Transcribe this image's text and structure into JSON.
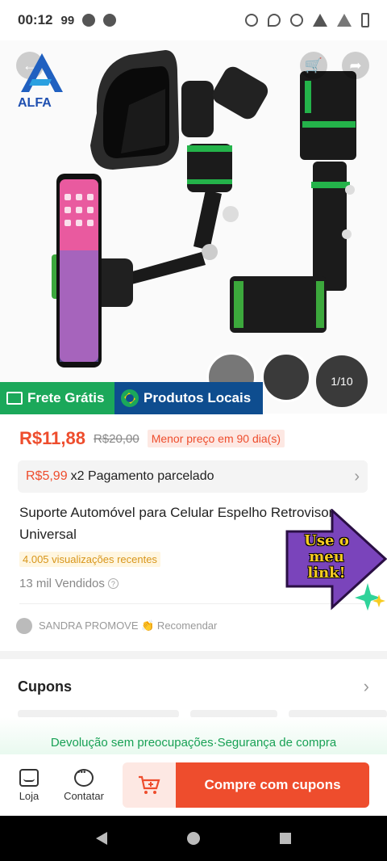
{
  "status_bar": {
    "time": "00:12",
    "notif_count": "99"
  },
  "hero": {
    "brand_logo_text": "ALFA",
    "thumb_counter": "1/10"
  },
  "badges": {
    "free_shipping": "Frete Grátis",
    "local_products": "Produtos Locais"
  },
  "pricing": {
    "price": "R$11,88",
    "old_price": "R$20,00",
    "lowest_price_tag": "Menor preço em 90 dia(s)"
  },
  "installment": {
    "price": "R$5,99",
    "rest": "x2 Pagamento parcelado"
  },
  "product": {
    "title": "Suporte Automóvel para Celular Espelho Retrovisor Universal",
    "recent_views": "4.005 visualizações recentes",
    "sold": "13 mil Vendidos"
  },
  "recommender": {
    "text": "SANDRA PROMOVE 👏 Recomendar"
  },
  "sticker": {
    "text": "Use o meu link!"
  },
  "coupons": {
    "title": "Cupons"
  },
  "guarantee": {
    "text": "Devolução sem preocupações·Segurança de compra"
  },
  "bottom_bar": {
    "store_label": "Loja",
    "chat_label": "Contatar",
    "buy_label": "Compre com cupons"
  },
  "colors": {
    "accent": "#ee4d2d",
    "green": "#1ba85a",
    "blue": "#0e4d8f"
  }
}
